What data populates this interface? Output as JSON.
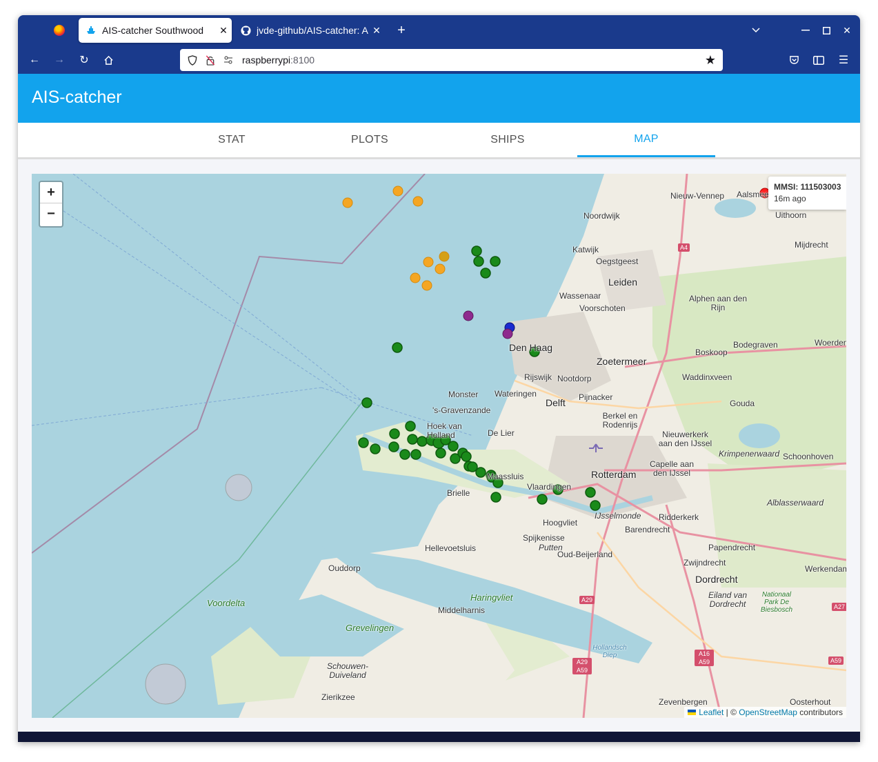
{
  "browser": {
    "tabs": [
      {
        "title": "AIS-catcher Southwood",
        "icon": "ship-icon",
        "active": true
      },
      {
        "title": "jvde-github/AIS-catcher: A",
        "icon": "github-icon",
        "active": false
      }
    ],
    "url_host": "raspberrypi",
    "url_port": ":8100"
  },
  "app": {
    "title": "AIS-catcher",
    "tabs": [
      "STAT",
      "PLOTS",
      "SHIPS",
      "MAP"
    ],
    "selected_tab": "MAP"
  },
  "map": {
    "zoom_in_label": "+",
    "zoom_out_label": "−",
    "popup": {
      "mmsi": "MMSI: 111503003",
      "age": "16m ago"
    },
    "attribution": {
      "leaflet": "Leaflet",
      "sep": " | © ",
      "osm": "OpenStreetMap",
      "suffix": " contributors"
    },
    "labels": [
      "Nieuw-Vennep",
      "Aalsmeer",
      "Uithoorn",
      "Noordwijk",
      "Katwijk",
      "Oegstgeest",
      "Mijdrecht",
      "Leiden",
      "Wassenaar",
      "Voorschoten",
      "Alphen aan den Rijn",
      "Den Haag",
      "Zoetermeer",
      "Bodegraven",
      "Woerden",
      "Rijswijk",
      "Nootdorp",
      "Boskoop",
      "Waddinxveen",
      "Monster",
      "Wateringen",
      "Delft",
      "Pijnacker",
      "Gouda",
      "'s-Gravenzande",
      "Berkel en Rodenrijs",
      "Hoek van Holland",
      "De Lier",
      "Nieuwerkerk aan den IJssel",
      "Krimpenerwaard",
      "Schoonhoven",
      "Capelle aan den IJssel",
      "Rotterdam",
      "Maassluis",
      "Vlaardingen",
      "Brielle",
      "Alblasserwaard",
      "IJsselmonde",
      "Ridderkerk",
      "Hoogvliet",
      "Barendrecht",
      "Spijkenisse",
      "Putten",
      "Oud-Beijerland",
      "Hellevoetsluis",
      "Papendrecht",
      "Zwijndrecht",
      "Werkendam",
      "Ouddorp",
      "Dordrecht",
      "Eiland van Dordrecht",
      "Nationaal Park De Biesbosch",
      "Voordelta",
      "Haringvliet",
      "Middelharnis",
      "Grevelingen",
      "Hollandsch Diep",
      "Schouwen-Duiveland",
      "Zierikzee",
      "Zevenbergen",
      "Oosterhout"
    ],
    "road_signs": [
      "A4",
      "A29",
      "A29 A59",
      "A16 A59",
      "A59",
      "A27"
    ]
  }
}
